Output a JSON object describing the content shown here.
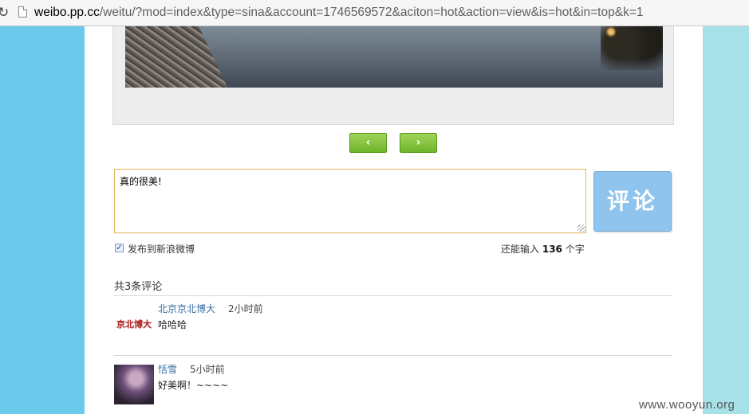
{
  "browser": {
    "url_host": "weibo.pp.cc",
    "url_path": "/weitu/?mod=index&type=sina&account=1746569572&aciton=hot&action=view&is=hot&in=top&k=1"
  },
  "nav": {
    "prev_label": "‹",
    "next_label": "›"
  },
  "comment_form": {
    "input_value": "真的很美!",
    "submit_label": "评论",
    "share_checked": true,
    "share_label": "发布到新浪微博",
    "remaining_prefix": "还能输入",
    "remaining_count": "136",
    "remaining_suffix": "个字"
  },
  "comments": {
    "title": "共3条评论",
    "items": [
      {
        "avatar_text": "京北博大",
        "author": "北京京北博大",
        "time": "2小时前",
        "text": "哈哈哈"
      },
      {
        "author": "恬雪",
        "time": "5小时前",
        "text": "好美啊！~~~~"
      }
    ]
  },
  "watermark": "www.wooyun.org",
  "colors": {
    "left_panel": "#6bcaec",
    "right_panel": "#a6e1e7",
    "nav_green": "#7dbf35",
    "submit_blue": "#8ec4ee",
    "input_border": "#e1b25a",
    "author_link": "#3a6ea5"
  }
}
